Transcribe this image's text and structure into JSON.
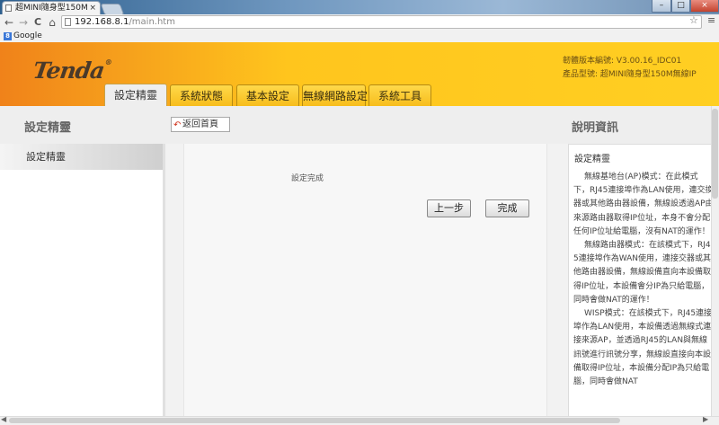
{
  "browser": {
    "tab_title": "超MINI隨身型150M",
    "tab_close": "×",
    "window_controls": {
      "minimize": "–",
      "maximize": "□",
      "close": "×"
    },
    "nav": {
      "back": "←",
      "forward": "→",
      "reload": "C",
      "home": "⌂"
    },
    "url_host": "192.168.8.1",
    "url_path": "/main.htm",
    "star": "☆",
    "menu": "≡",
    "bookmarks": [
      {
        "label": "Google",
        "icon": "google-icon"
      }
    ]
  },
  "router": {
    "logo": "Tenda",
    "logo_mark": "®",
    "firmware": "韌體版本編號: V3.00.16_IDC01",
    "model": "產品型號: 超MINI隨身型150M無線IP",
    "tabs": [
      {
        "label": "設定精靈",
        "active": true
      },
      {
        "label": "系統狀態",
        "active": false
      },
      {
        "label": "基本設定",
        "active": false
      },
      {
        "label": "無線網路設定",
        "active": false
      },
      {
        "label": "系統工具",
        "active": false
      }
    ],
    "left_heading": "設定精靈",
    "sidebar_items": [
      {
        "label": "設定精靈",
        "selected": true
      }
    ],
    "back_home": "返回首頁",
    "main": {
      "status_text": "設定完成",
      "prev_button": "上一步",
      "finish_button": "完成"
    },
    "help": {
      "heading": "說明資訊",
      "title": "設定精靈",
      "paragraphs": [
        "無線基地台(AP)模式：在此模式下，RJ45連接埠作為LAN使用，連交換器或其他路由器設備，無線設透過AP由來源路由器取得IP位址，本身不會分配任何IP位址給電腦，沒有NAT的運作！",
        "無線路由器模式：在該模式下，RJ45連接埠作為WAN使用，連接交器或其他路由器設備，無線設備直向本設備取得IP位址，本設備會分IP為只給電腦，同時會做NAT的運作！",
        "WISP模式：在該模式下，RJ45連接埠作為LAN使用，本設備透過無線式連接來源AP，並透過RJ45的LAN與無線訊號進行訊號分享，無線設直接向本設備取得IP位址，本設備分配IP為只給電腦，同時會做NAT"
      ]
    }
  },
  "colors": {
    "banner_start": "#f0821a",
    "banner_end": "#ffcf22",
    "tab_fill": "#f7bd1c",
    "page_gray": "#eeeeee"
  }
}
